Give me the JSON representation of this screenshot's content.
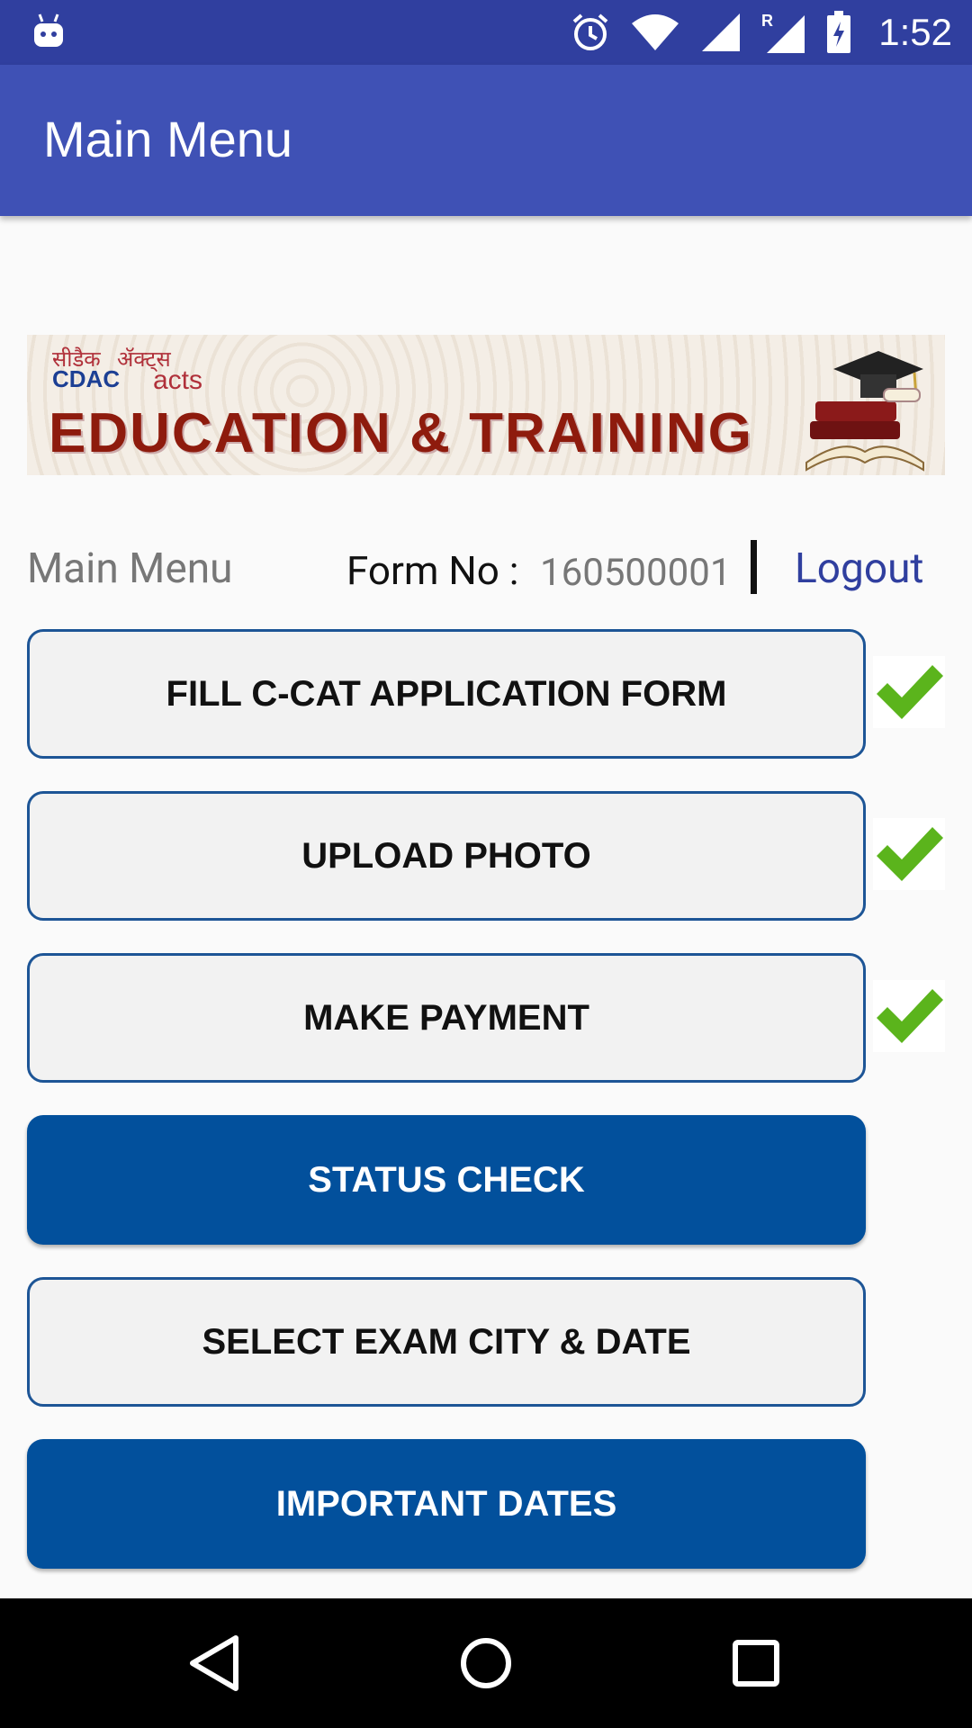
{
  "status_bar": {
    "time": "1:52",
    "icons": [
      "android-icon",
      "alarm-icon",
      "wifi-icon",
      "signal-icon",
      "roaming-signal-icon",
      "battery-charging-icon"
    ],
    "color": "#303f9f"
  },
  "app_bar": {
    "title": "Main Menu",
    "color": "#3f51b5"
  },
  "banner": {
    "logo_hindi_1": "सीडैक",
    "logo_cdac": "CDAC",
    "logo_hindi_2": "ॲक्ट्स",
    "logo_acts": "acts",
    "title": "EDUCATION & TRAINING"
  },
  "header": {
    "menu_label": "Main Menu",
    "form_no_label": "Form No :",
    "form_no_value": "160500001",
    "logout_label": "Logout"
  },
  "buttons": [
    {
      "label": "FILL C-CAT APPLICATION FORM",
      "style": "light",
      "checked": true
    },
    {
      "label": "UPLOAD PHOTO",
      "style": "light",
      "checked": true
    },
    {
      "label": "MAKE PAYMENT",
      "style": "light",
      "checked": true
    },
    {
      "label": "STATUS CHECK",
      "style": "dark",
      "checked": false
    },
    {
      "label": "SELECT EXAM CITY & DATE",
      "style": "light",
      "checked": false
    },
    {
      "label": "IMPORTANT DATES",
      "style": "dark",
      "checked": false
    }
  ],
  "colors": {
    "dark_button": "#02509c",
    "check": "#5bb41c",
    "link": "#303f9f"
  },
  "nav_bar": {
    "icons": [
      "back-icon",
      "home-icon",
      "recents-icon"
    ]
  }
}
